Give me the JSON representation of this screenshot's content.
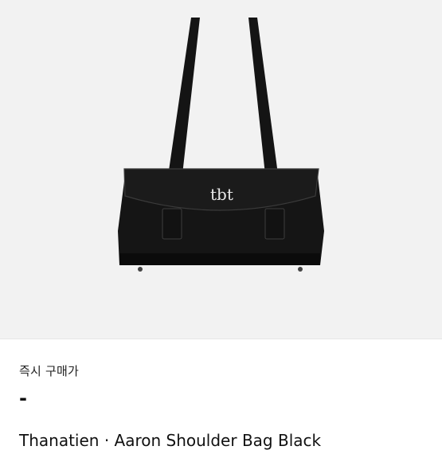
{
  "product": {
    "image_alt": "black shoulder bag with tbt logo",
    "logo_text": "tbt",
    "buy_now_label": "즉시 구매가",
    "price": "-",
    "title": "Thanatien · Aaron Shoulder Bag Black"
  }
}
